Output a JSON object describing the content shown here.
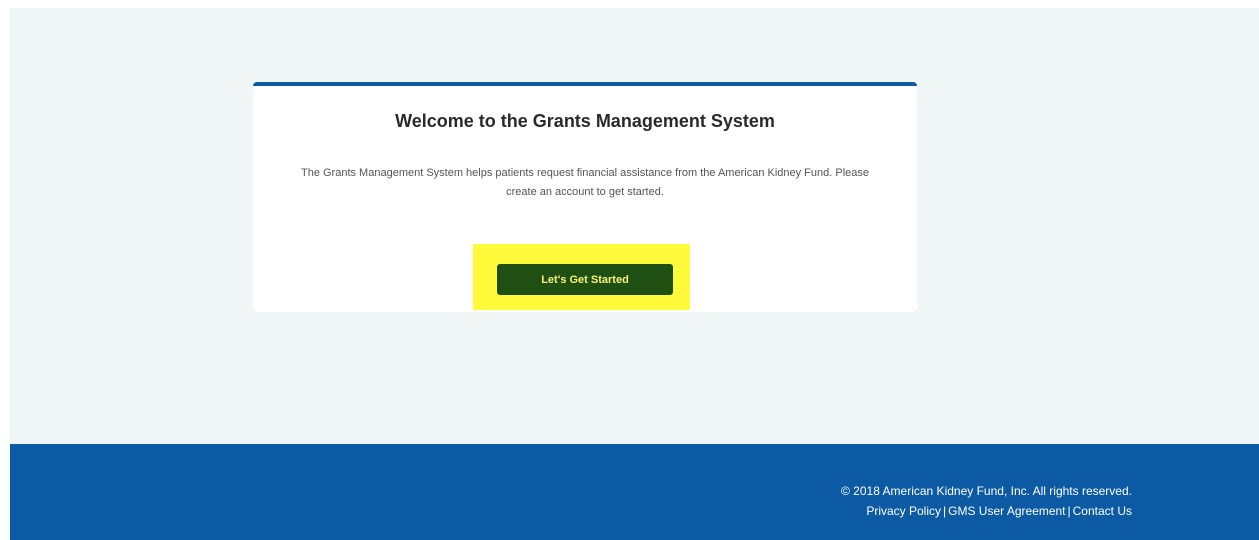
{
  "card": {
    "title": "Welcome to the Grants Management System",
    "text": "The Grants Management System helps patients request financial assistance from the American Kidney Fund. Please create an account to get started.",
    "button_label": "Let's Get Started"
  },
  "footer": {
    "copyright": "© 2018 American Kidney Fund, Inc. All rights reserved.",
    "links": [
      {
        "label": "Privacy Policy"
      },
      {
        "label": "GMS User Agreement"
      },
      {
        "label": "Contact Us"
      }
    ],
    "separator": "|"
  },
  "colors": {
    "brand_blue": "#0b5aa3",
    "button_green": "#1f4f12",
    "button_text": "#f6f47a",
    "highlight_yellow": "#fffa3a",
    "page_background": "#f1f6f6"
  }
}
